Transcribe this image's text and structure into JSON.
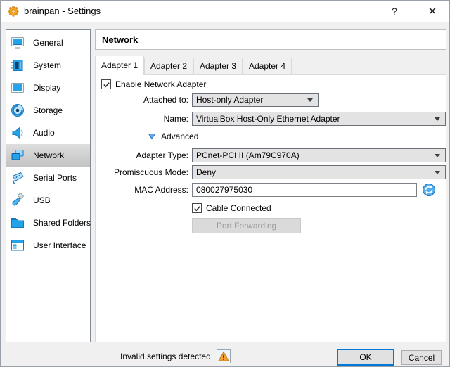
{
  "window": {
    "title": "brainpan - Settings",
    "help_label": "?",
    "close_label": "✕"
  },
  "sidebar": {
    "selected_item": "Network",
    "items": [
      {
        "label": "General",
        "selected": false
      },
      {
        "label": "System",
        "selected": false
      },
      {
        "label": "Display",
        "selected": false
      },
      {
        "label": "Storage",
        "selected": false
      },
      {
        "label": "Audio",
        "selected": false
      },
      {
        "label": "Network",
        "selected": true
      },
      {
        "label": "Serial Ports",
        "selected": false
      },
      {
        "label": "USB",
        "selected": false
      },
      {
        "label": "Shared Folders",
        "selected": false
      },
      {
        "label": "User Interface",
        "selected": false
      }
    ]
  },
  "main": {
    "heading": "Network",
    "tabs": [
      {
        "label": "Adapter 1",
        "selected": true
      },
      {
        "label": "Adapter 2",
        "selected": false
      },
      {
        "label": "Adapter 3",
        "selected": false
      },
      {
        "label": "Adapter 4",
        "selected": false
      }
    ],
    "form": {
      "enable_label": "Enable Network Adapter",
      "enable_checked": true,
      "attached_to_label": "Attached to:",
      "attached_to_value": "Host-only Adapter",
      "name_label": "Name:",
      "name_value": "VirtualBox Host-Only Ethernet Adapter",
      "advanced_label": "Advanced",
      "adapter_type_label": "Adapter Type:",
      "adapter_type_value": "PCnet-PCI II (Am79C970A)",
      "promiscuous_label": "Promiscuous Mode:",
      "promiscuous_value": "Deny",
      "mac_label": "MAC Address:",
      "mac_value": "080027975030",
      "cable_label": "Cable Connected",
      "cable_checked": true,
      "port_forwarding_label": "Port Forwarding"
    }
  },
  "footer": {
    "status": "Invalid settings detected",
    "ok_label": "OK",
    "cancel_label": "Cancel"
  },
  "colors": {
    "accent_blue": "#0078d7",
    "icon_blue": "#25a3e9",
    "warning_orange": "#f7a13a",
    "selected_row_gray": "#cfcfcf",
    "dialog_bg": "#f0f0f0"
  }
}
